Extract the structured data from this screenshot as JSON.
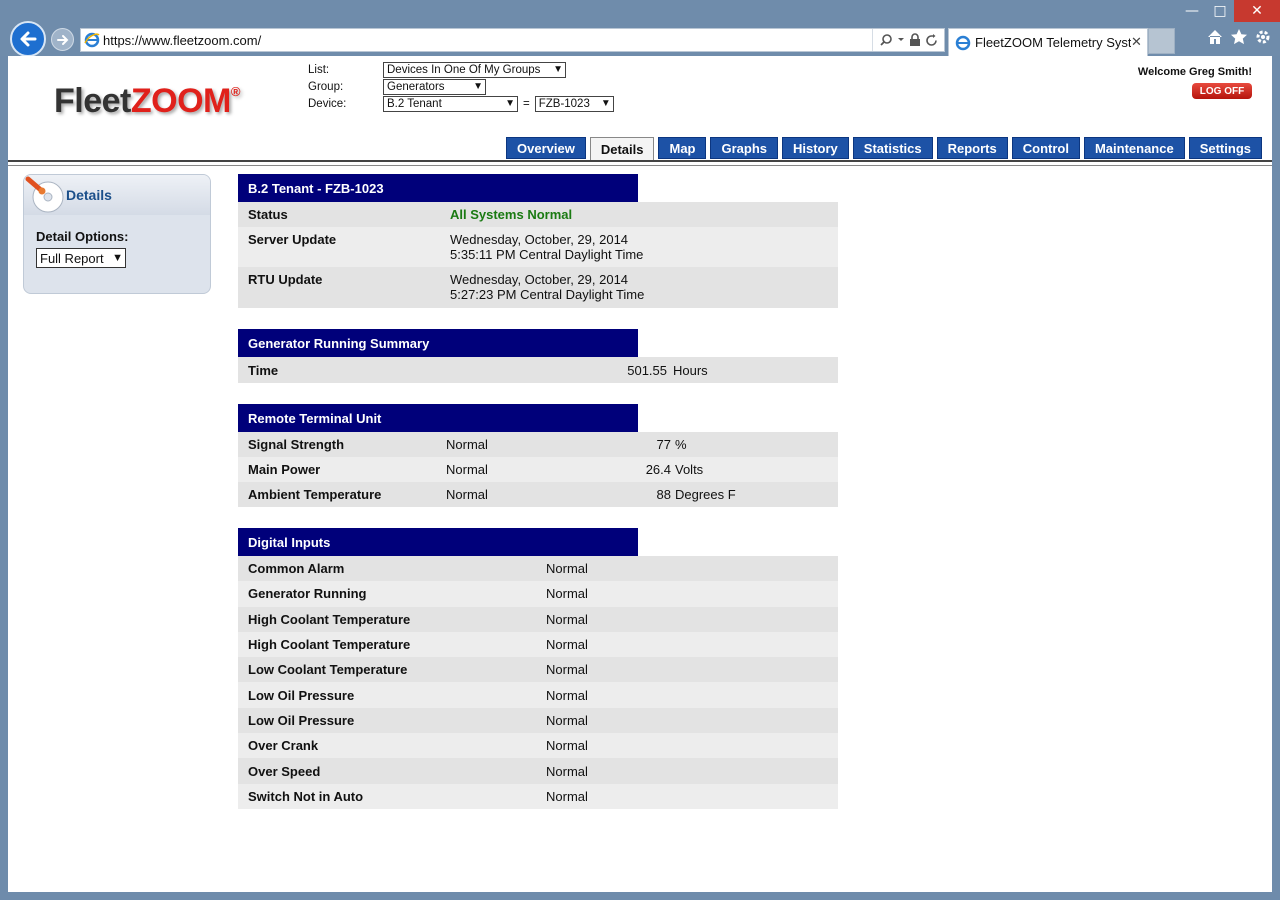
{
  "browser": {
    "url": "https://www.fleetzoom.com/",
    "tab_title": "FleetZOOM Telemetry Syst...",
    "win_min": "—",
    "win_max": "□",
    "win_close": "✕"
  },
  "header": {
    "logo_part1": "Fleet",
    "logo_part2": "ZOOM",
    "logo_reg": "®",
    "list_label": "List:",
    "list_value": "Devices In One Of My Groups",
    "group_label": "Group:",
    "group_value": "Generators",
    "device_label": "Device:",
    "device_value": "B.2 Tenant",
    "equals": "=",
    "device_id_value": "FZB-1023",
    "welcome": "Welcome Greg Smith!",
    "logoff": "LOG OFF"
  },
  "tabs": [
    {
      "label": "Overview"
    },
    {
      "label": "Details"
    },
    {
      "label": "Map"
    },
    {
      "label": "Graphs"
    },
    {
      "label": "History"
    },
    {
      "label": "Statistics"
    },
    {
      "label": "Reports"
    },
    {
      "label": "Control"
    },
    {
      "label": "Maintenance"
    },
    {
      "label": "Settings"
    }
  ],
  "sidebar": {
    "title": "Details",
    "detail_options_label": "Detail Options:",
    "report_option": "Full Report"
  },
  "device_section": {
    "title": "B.2 Tenant - FZB-1023",
    "status_label": "Status",
    "status_value": "All Systems Normal",
    "server_label": "Server Update",
    "server_date": "Wednesday, October, 29, 2014",
    "server_time": "5:35:11 PM Central Daylight Time",
    "rtu_label": "RTU Update",
    "rtu_date": "Wednesday, October, 29, 2014",
    "rtu_time": "5:27:23 PM Central Daylight Time"
  },
  "gen_summary": {
    "title": "Generator Running Summary",
    "time_label": "Time",
    "time_value": "501.55",
    "time_unit": "Hours"
  },
  "rtu": {
    "title": "Remote Terminal Unit",
    "rows": [
      {
        "label": "Signal Strength",
        "status": "Normal",
        "value": "77",
        "unit": "%"
      },
      {
        "label": "Main Power",
        "status": "Normal",
        "value": "26.4",
        "unit": "Volts"
      },
      {
        "label": "Ambient Temperature",
        "status": "Normal",
        "value": "88",
        "unit": "Degrees F"
      }
    ]
  },
  "digital": {
    "title": "Digital Inputs",
    "rows": [
      {
        "label": "Common Alarm",
        "status": "Normal"
      },
      {
        "label": "Generator Running",
        "status": "Normal"
      },
      {
        "label": "High Coolant Temperature",
        "status": "Normal"
      },
      {
        "label": "High Coolant Temperature",
        "status": "Normal"
      },
      {
        "label": "Low Coolant Temperature",
        "status": "Normal"
      },
      {
        "label": "Low Oil Pressure",
        "status": "Normal"
      },
      {
        "label": "Low Oil Pressure",
        "status": "Normal"
      },
      {
        "label": "Over Crank",
        "status": "Normal"
      },
      {
        "label": "Over Speed",
        "status": "Normal"
      },
      {
        "label": "Switch Not in Auto",
        "status": "Normal"
      }
    ]
  }
}
